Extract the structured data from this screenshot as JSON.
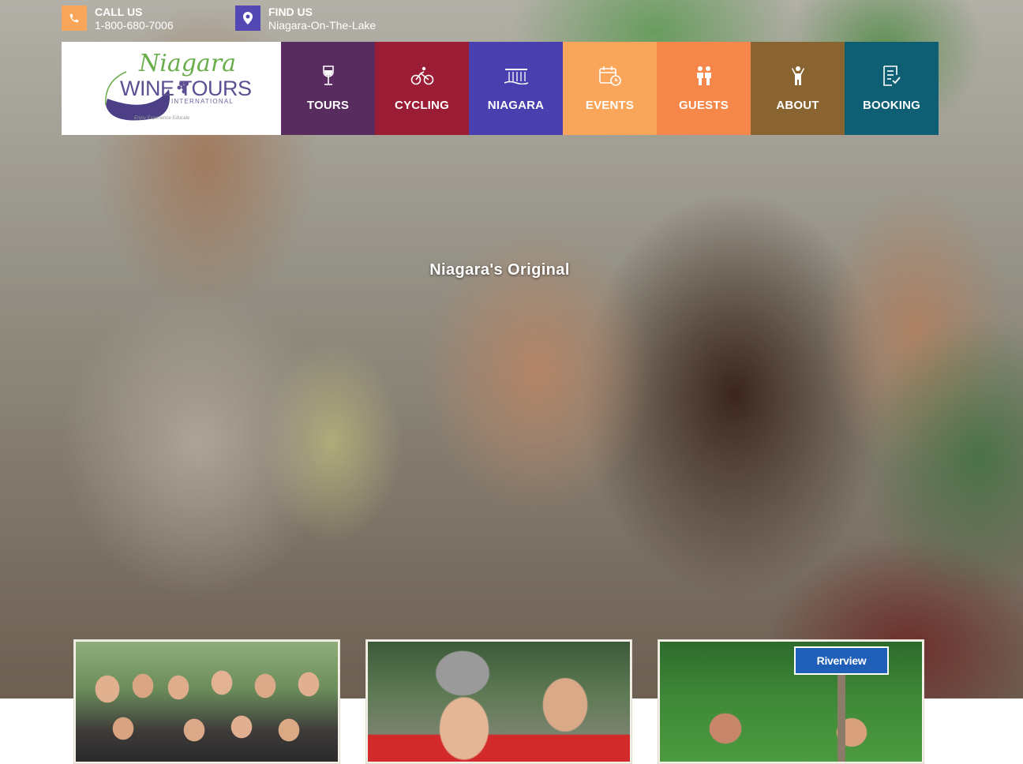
{
  "contact": {
    "call": {
      "title": "CALL US",
      "value": "1-800-680-7006",
      "icon": "phone-icon",
      "color": "#f9a65b"
    },
    "find": {
      "title": "FIND US",
      "value": "Niagara-On-The-Lake",
      "icon": "map-pin-icon",
      "color": "#5348b3"
    }
  },
  "logo": {
    "script": "Niagara",
    "wordmark": "WINE TOURS",
    "sub": "INTERNATIONAL",
    "tagline": "Enjoy Experience Educate"
  },
  "nav": [
    {
      "label": "TOURS",
      "icon": "wine-glass-icon",
      "color": "#582c5e"
    },
    {
      "label": "CYCLING",
      "icon": "bicycle-icon",
      "color": "#9b1c35"
    },
    {
      "label": "NIAGARA",
      "icon": "waterfall-icon",
      "color": "#4a3fae"
    },
    {
      "label": "EVENTS",
      "icon": "calendar-icon",
      "color": "#f9a65b"
    },
    {
      "label": "GUESTS",
      "icon": "guests-icon",
      "color": "#f5874a"
    },
    {
      "label": "ABOUT",
      "icon": "person-icon",
      "color": "#8a6430"
    },
    {
      "label": "BOOKING",
      "icon": "checklist-icon",
      "color": "#0e5f73"
    }
  ],
  "hero": {
    "headline": "Niagara's Original"
  },
  "cards": [
    {
      "name": "group-tour-card"
    },
    {
      "name": "cycling-tour-card"
    },
    {
      "name": "riverview-card",
      "sign": "Riverview"
    }
  ]
}
